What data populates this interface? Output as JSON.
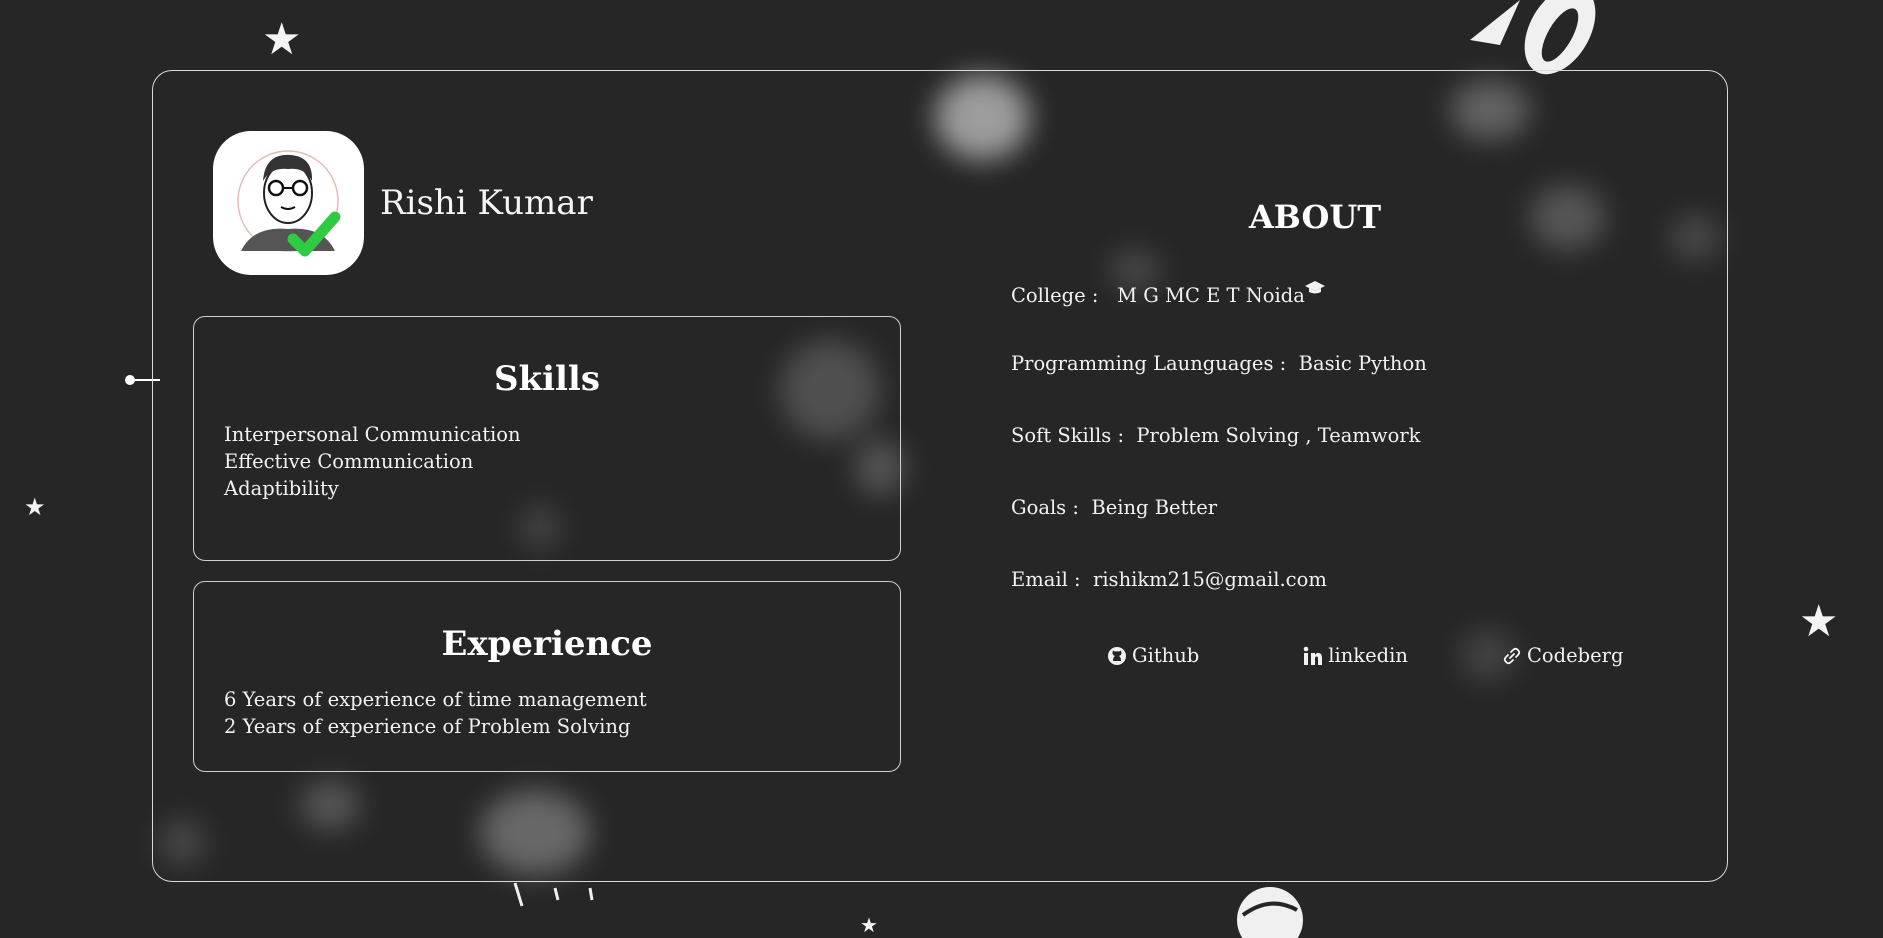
{
  "profile": {
    "name": "Rishi Kumar"
  },
  "skills": {
    "title": "Skills",
    "items": [
      "Interpersonal Communication",
      "Effective Communication",
      "Adaptibility"
    ]
  },
  "experience": {
    "title": "Experience",
    "items": [
      "6 Years of experience of time management",
      "2 Years of experience of Problem Solving"
    ]
  },
  "about": {
    "title": "ABOUT",
    "rows": [
      {
        "label": "College :",
        "value": "M G MC E T Noida",
        "icon": "graduation-cap-icon"
      },
      {
        "label": "Programming Launguages :",
        "value": "Basic Python"
      },
      {
        "label": "Soft Skills :",
        "value": "Problem Solving , Teamwork"
      },
      {
        "label": "Goals :",
        "value": "Being Better"
      },
      {
        "label": "Email :",
        "value": "rishikm215@gmail.com"
      }
    ]
  },
  "links": [
    {
      "label": "Github",
      "icon": "github-icon"
    },
    {
      "label": "linkedin",
      "icon": "linkedin-icon"
    },
    {
      "label": "Codeberg",
      "icon": "link-icon"
    }
  ],
  "colors": {
    "background": "#262626",
    "border": "#d9d9d9",
    "text": "#f2f2f2",
    "check": "#2ecc40"
  }
}
